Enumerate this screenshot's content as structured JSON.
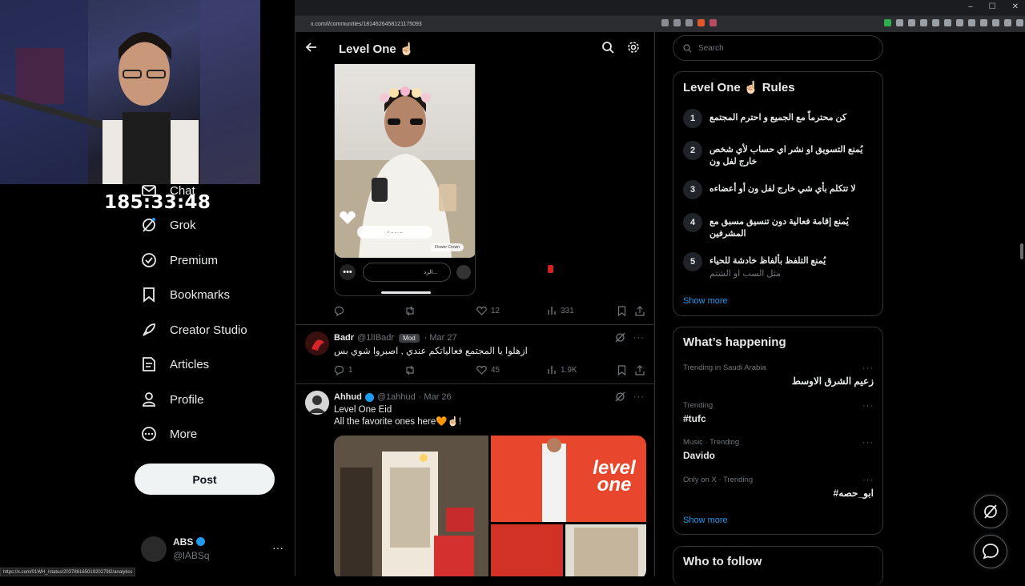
{
  "browser": {
    "url": "x.com/i/communities/1814626458121175093",
    "status_url": "https://x.com/01WH_/status/20378616501920279l2/analytics",
    "window_controls": [
      "–",
      "☐",
      "✕"
    ]
  },
  "stream": {
    "timer": "185:33:48"
  },
  "nav": {
    "items": [
      {
        "label": "Chat",
        "icon": "mail-icon"
      },
      {
        "label": "Grok",
        "icon": "grok-icon"
      },
      {
        "label": "Premium",
        "icon": "premium-icon"
      },
      {
        "label": "Bookmarks",
        "icon": "bookmark-icon"
      },
      {
        "label": "Creator Studio",
        "icon": "rocket-icon"
      },
      {
        "label": "Articles",
        "icon": "article-icon"
      },
      {
        "label": "Profile",
        "icon": "person-icon"
      },
      {
        "label": "More",
        "icon": "more-circle-icon"
      }
    ],
    "post_button": "Post",
    "account": {
      "name": "ABS",
      "handle": "@lABSq",
      "more": "···"
    }
  },
  "main": {
    "header_title": "Level One ☝🏻",
    "post1": {
      "media": {
        "music_text": "♪ ... ... ...",
        "filter_name": "Flower Crown",
        "reply_placeholder": "الرد...",
        "more": "•••"
      },
      "actions": {
        "replies": "",
        "likes": "12",
        "views": "331"
      }
    },
    "post2": {
      "name": "Badr",
      "handle": "@1lIBadr",
      "badge": "Mod",
      "date": "· Mar 27",
      "text": "ازهلوا يا المجتمع فعالياتكم عندي , اصبروا شوي بس",
      "actions": {
        "replies": "1",
        "likes": "45",
        "views": "1.9K"
      }
    },
    "post3": {
      "name": "Ahhud",
      "handle": "@1ahhud",
      "date": "· Mar 26",
      "line1": "Level One Eid",
      "line2": "All the favorite ones here🧡☝🏻!",
      "media_text": "level one"
    }
  },
  "sidebar": {
    "search_placeholder": "Search",
    "rules": {
      "title": "Level One ☝🏻 Rules",
      "items": [
        {
          "n": "1",
          "text": "كن محترماً مع الجميع و احترم المجتمع"
        },
        {
          "n": "2",
          "text": "يُمنع التسويق او نشر اي حساب لأي شخص خارج لفل ون"
        },
        {
          "n": "3",
          "text": "لا تتكلم بأي شي خارج لفل ون أو أعضاءه"
        },
        {
          "n": "4",
          "text": "يُمنع إقامة فعالية دون تنسيق مسبق مع المشرفين"
        },
        {
          "n": "5",
          "text": "يُمنع التلفظ بألفاظ خادشة للحياء",
          "sub": "مثل السب او الشتم"
        }
      ],
      "show_more": "Show more"
    },
    "happening": {
      "title": "What’s happening",
      "trends": [
        {
          "ctx": "Trending in Saudi Arabia",
          "title": "زعيم الشرق الاوسط"
        },
        {
          "ctx": "Trending",
          "title": "#tufc"
        },
        {
          "ctx": "Music · Trending",
          "title": "Davido"
        },
        {
          "ctx": "Only on X · Trending",
          "title": "#ابو_حصه"
        }
      ],
      "show_more": "Show more",
      "dots": "···"
    },
    "who_to_follow": "Who to follow"
  },
  "colors": {
    "accent": "#1d9bf0",
    "background": "#000000",
    "border": "#2f3336",
    "muted": "#71767b"
  }
}
